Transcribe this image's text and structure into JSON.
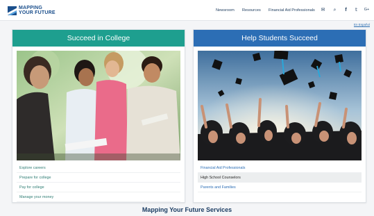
{
  "logo": {
    "line1": "MAPPING",
    "line2": "YOUR FUTURE"
  },
  "nav": {
    "items": [
      "Newsroom",
      "Resources",
      "Financial Aid Professionals"
    ],
    "icons": [
      "envelope-icon",
      "search-icon",
      "facebook-icon",
      "twitter-icon",
      "google-plus-icon"
    ],
    "icon_glyphs": [
      "✉",
      "⌕",
      "f",
      "𝕥",
      "G+"
    ]
  },
  "language_link": "En Español",
  "cards": [
    {
      "title": "Succeed in College",
      "color": "#1e9f8f",
      "links": [
        "Explore careers",
        "Prepare for college",
        "Pay for college",
        "Manage your money"
      ]
    },
    {
      "title": "Help Students Succeed",
      "color": "#2c6eb5",
      "links": [
        "Financial Aid Professionals",
        "High School Counselors",
        "Parents and Families"
      ]
    }
  ],
  "services_heading": "Mapping Your Future Services"
}
